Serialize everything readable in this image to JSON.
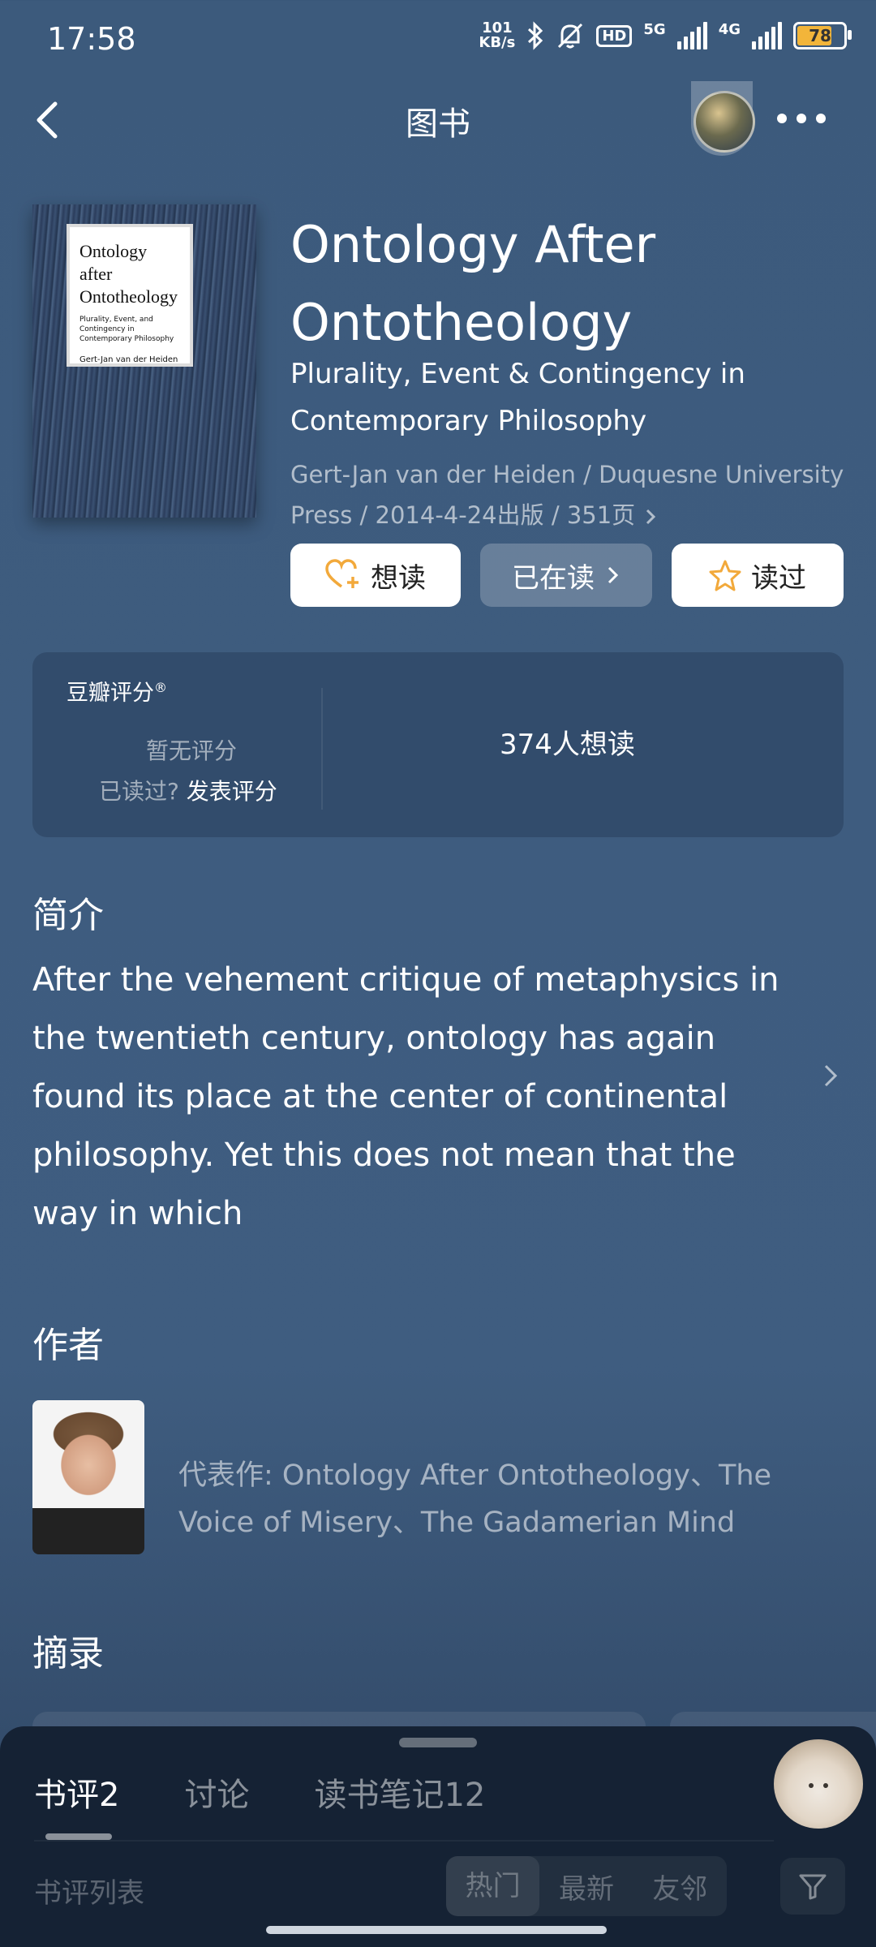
{
  "status": {
    "time": "17:58",
    "net_speed_top": "101",
    "net_speed_unit": "KB/s",
    "hd": "HD",
    "sig1": "5G",
    "sig2": "4G",
    "battery": "78"
  },
  "nav": {
    "title": "图书"
  },
  "book": {
    "cover_title": "Ontology after Ontotheology",
    "cover_subtitle": "Plurality, Event, and Contingency in Contemporary Philosophy",
    "cover_author": "Gert-Jan van der Heiden",
    "title": "Ontology After Ontotheology",
    "subtitle": "Plurality, Event & Contingency in Contemporary Philosophy",
    "meta": "Gert-Jan van der Heiden / Duquesne University Press / 2014-4-24出版 / 351页",
    "actions": {
      "want": "想读",
      "reading": "已在读",
      "read": "读过"
    }
  },
  "rating": {
    "label": "豆瓣评分",
    "registered": "®",
    "no_rating": "暂无评分",
    "read_question": "已读过?",
    "rate_link": "发表评分",
    "want_count": "374人想读"
  },
  "intro": {
    "heading": "简介",
    "text": "After the vehement critique of metaphysics in the twentieth century, ontology has again found its place at the center of continental philosophy. Yet this does not mean that the way in which"
  },
  "author": {
    "heading": "作者",
    "works": "代表作: Ontology After Ontotheology、The Voice of Misery、The Gadamerian Mind"
  },
  "excerpt": {
    "heading": "摘录"
  },
  "sheet": {
    "tabs": [
      {
        "label": "书评",
        "count": "2"
      },
      {
        "label": "讨论",
        "count": ""
      },
      {
        "label": "读书笔记",
        "count": "12"
      }
    ],
    "list_label": "书评列表",
    "sort": [
      "热门",
      "最新",
      "友邻"
    ]
  },
  "colors": {
    "background": "#3e5c7f",
    "sheet": "#152234",
    "star": "#f2a93b",
    "battery": "#f2b53a"
  }
}
